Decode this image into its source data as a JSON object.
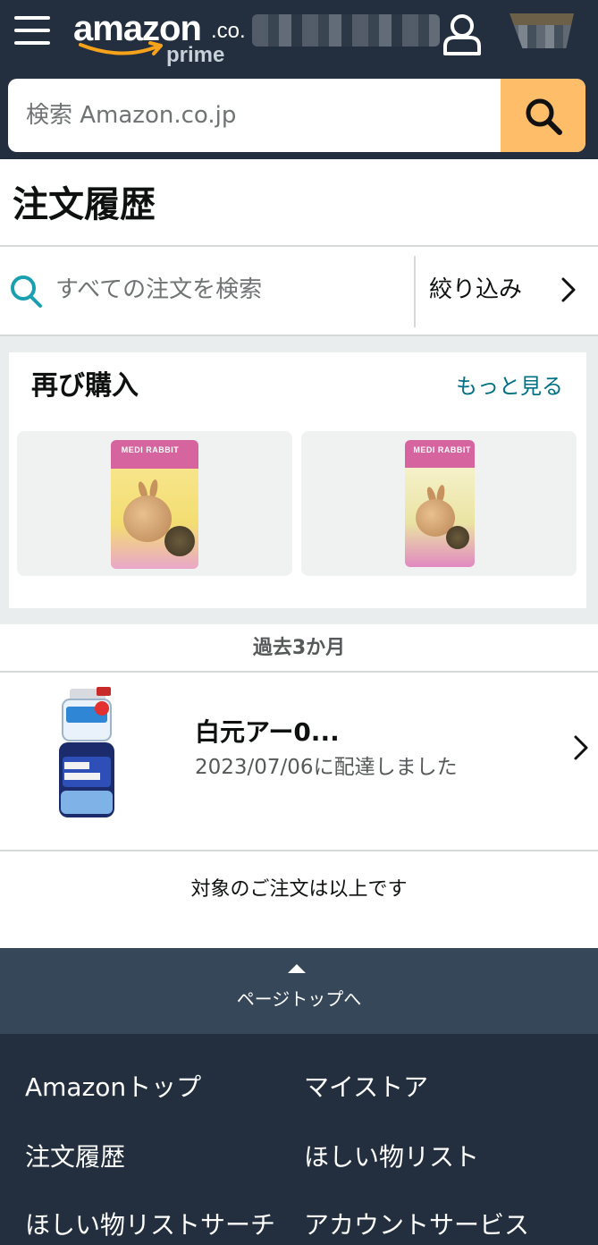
{
  "header": {
    "logo_text": "amazon",
    "logo_suffix": ".co.",
    "logo_sub": "prime",
    "menu_icon": "hamburger-menu-icon",
    "account_icon": "user-icon",
    "cart_icon": "cart-icon"
  },
  "search": {
    "placeholder": "検索 Amazon.co.jp",
    "button_icon": "search-icon"
  },
  "page": {
    "title": "注文履歴"
  },
  "order_search": {
    "placeholder": "すべての注文を検索",
    "filter_label": "絞り込み"
  },
  "buy_again": {
    "title": "再び購入",
    "see_more": "もっと見る",
    "items": [
      {
        "name": "MEDI RABBIT"
      },
      {
        "name": "MEDI RABBIT"
      }
    ]
  },
  "orders": {
    "period": "過去3か月",
    "items": [
      {
        "title": "白元アー0...",
        "status": "2023/07/06に配達しました"
      }
    ],
    "end_message": "対象のご注文は以上です"
  },
  "back_to_top": {
    "label": "ページトップへ"
  },
  "footer": {
    "links": [
      "Amazonトップ",
      "マイストア",
      "注文履歴",
      "ほしい物リスト",
      "ほしい物リストサーチ",
      "アカウントサービス"
    ]
  },
  "colors": {
    "header_bg": "#232f3e",
    "search_button": "#febd69",
    "link": "#007185",
    "back_to_top_bg": "#37475a"
  }
}
